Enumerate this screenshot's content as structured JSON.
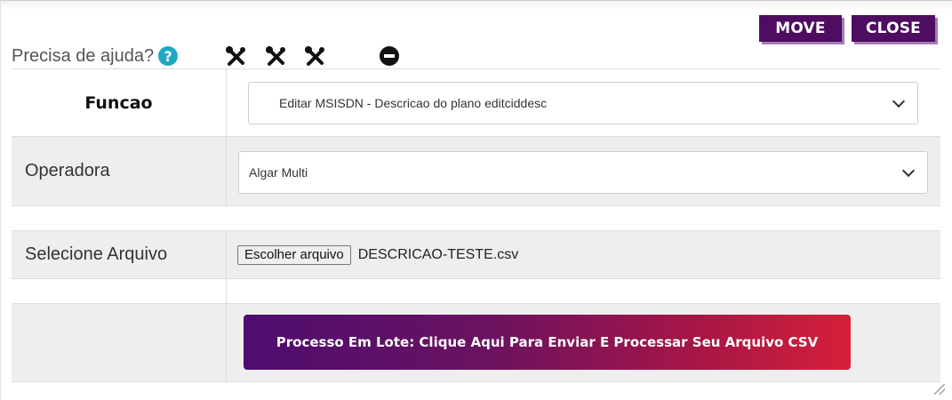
{
  "header": {
    "move_label": "MOVE",
    "close_label": "CLOSE",
    "help_text": "Precisa de ajuda?",
    "help_icon": "question-circle-icon",
    "tool_icons": [
      "tools-icon",
      "tools-icon",
      "tools-icon"
    ],
    "minus_icon": "minus-circle-icon"
  },
  "form": {
    "funcao_label": "Funcao",
    "funcao_value": "Editar MSISDN - Descricao do plano editciddesc",
    "operadora_label": "Operadora",
    "operadora_value": "Algar Multi",
    "arquivo_label": "Selecione Arquivo",
    "file_button_label": "Escolher arquivo",
    "file_name": "DESCRICAO-TESTE.csv",
    "submit_label": "Processo Em Lote: Clique Aqui Para Enviar E Processar Seu Arquivo CSV"
  },
  "colors": {
    "accent": "#4e0d61",
    "gradient_start": "#4e0d6f",
    "gradient_end": "#d5203a",
    "help_icon": "#1da8c4"
  }
}
